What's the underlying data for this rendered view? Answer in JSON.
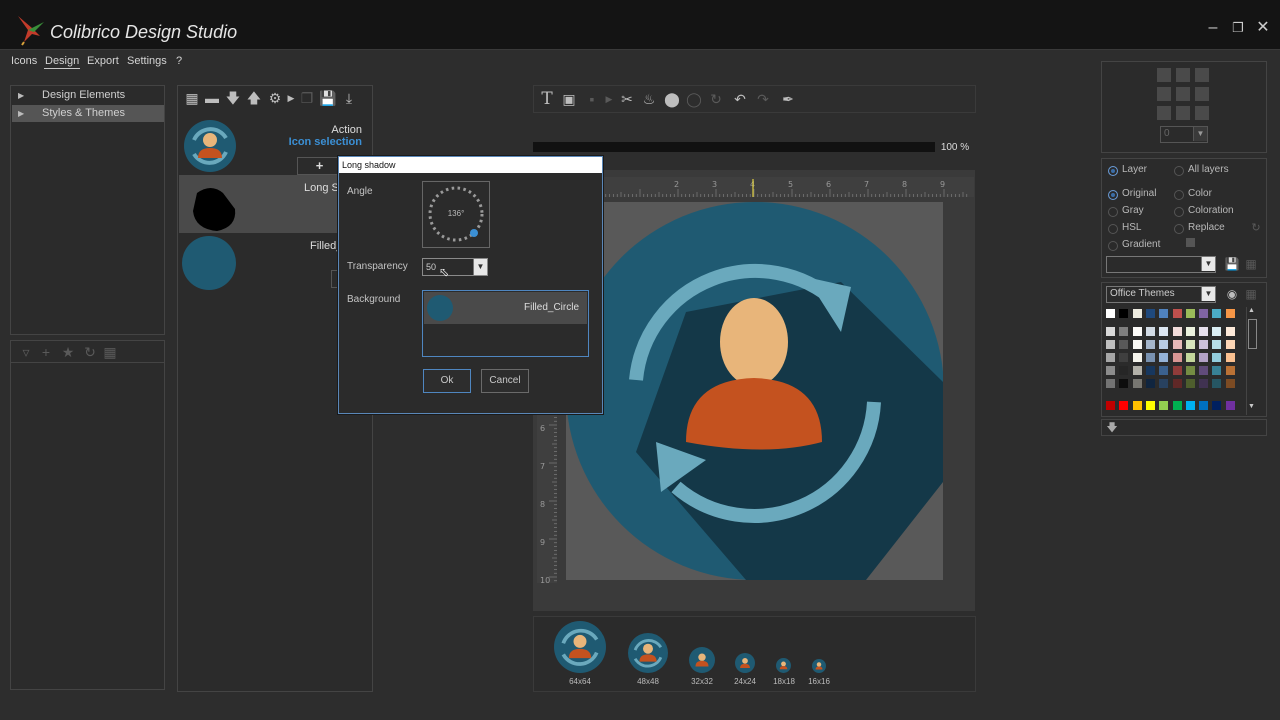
{
  "app": {
    "title": "Colibrico Design Studio"
  },
  "menu": {
    "items": [
      "Icons",
      "Design",
      "Export",
      "Settings",
      "?"
    ],
    "active": "Design"
  },
  "tree": {
    "items": [
      "Design Elements",
      "Styles & Themes"
    ]
  },
  "layers": {
    "action_label": "Action",
    "action_value": "Icon selection",
    "add_symbol": "+",
    "rows": [
      {
        "label": "Long Sh"
      },
      {
        "label": "Filled_"
      }
    ]
  },
  "canvas": {
    "zoom": "100 %",
    "ruler_top": [
      "1",
      "2",
      "3",
      "4",
      "5",
      "6",
      "7",
      "8",
      "9",
      "10"
    ],
    "ruler_left": [
      "6",
      "7",
      "8",
      "9",
      "10"
    ]
  },
  "dialog": {
    "title": "Long shadow",
    "angle_label": "Angle",
    "angle_value": "136°",
    "transparency_label": "Transparency",
    "transparency_value": "50",
    "background_label": "Background",
    "background_item": "Filled_Circle",
    "ok": "Ok",
    "cancel": "Cancel"
  },
  "right": {
    "small_combo": "0",
    "layer_opts": {
      "layer": "Layer",
      "all": "All layers"
    },
    "color_opts": [
      "Original",
      "Color",
      "Gray",
      "Coloration",
      "HSL",
      "Replace",
      "Gradient"
    ],
    "theme": "Office Themes"
  },
  "previews": [
    "64x64",
    "48x48",
    "32x32",
    "24x24",
    "18x18",
    "16x16"
  ],
  "colors": {
    "accent": "#3b8fd4",
    "circle": "#1f5a72",
    "shadow": "#143848",
    "arrow": "#6aa9bd",
    "skin": "#e8b57a",
    "body": "#c4521f"
  }
}
